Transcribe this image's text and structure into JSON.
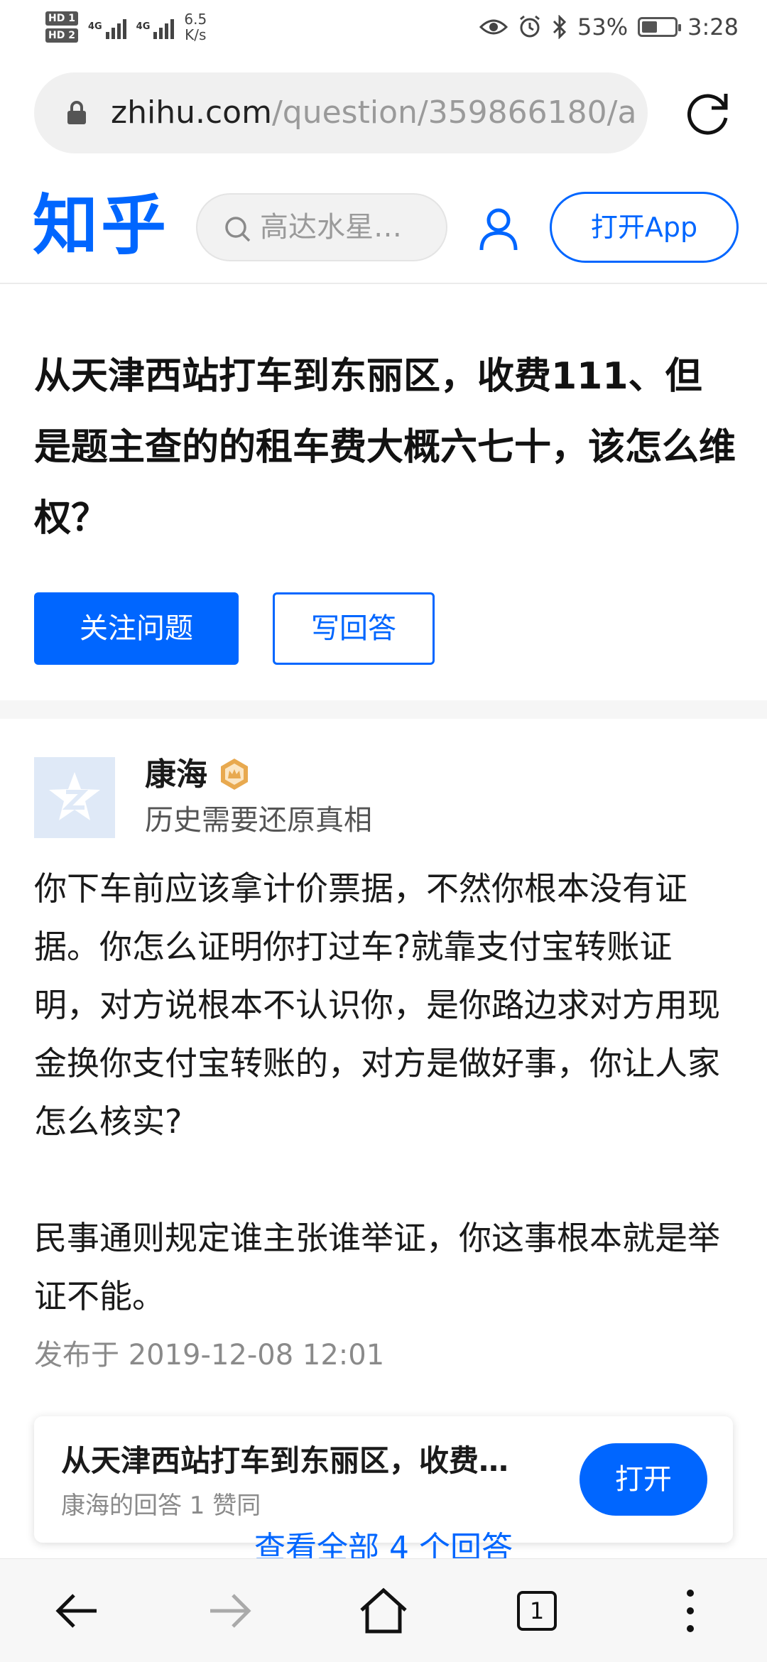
{
  "status_bar": {
    "hd1": "HD 1",
    "hd2": "HD 2",
    "network1": "4G",
    "network2": "4G",
    "speed_value": "6.5",
    "speed_unit": "K/s",
    "battery": "53%",
    "battery_level": 0.53,
    "time": "3:28",
    "icons": [
      "eye-icon",
      "alarm-icon",
      "bluetooth-icon",
      "battery-icon"
    ]
  },
  "url_bar": {
    "host": "zhihu.com",
    "path": "/question/359866180/a"
  },
  "header": {
    "logo": "知乎",
    "search_placeholder": "高达水星…",
    "open_app": "打开App"
  },
  "question": {
    "title": "从天津西站打车到东丽区，收费111、但是题主查的的租车费大概六七十，该怎么维权？",
    "follow_label": "关注问题",
    "answer_label": "写回答"
  },
  "answer": {
    "author": "康海",
    "bio": "历史需要还原真相",
    "paragraphs": [
      "你下车前应该拿计价票据，不然你根本没有证据。你怎么证明你打过车?就靠支付宝转账证明，对方说根本不认识你，是你路边求对方用现金换你支付宝转账的，对方是做好事，你让人家怎么核实?",
      "民事通则规定谁主张谁举证，你这事根本就是举证不能。"
    ],
    "published": "发布于 2019-12-08 12:01"
  },
  "card": {
    "title": "从天津西站打车到东丽区，收费…",
    "meta": "康海的回答 1 赞同",
    "open_label": "打开"
  },
  "view_all": "查看全部 4 个回答",
  "nav": {
    "tab_count": "1"
  },
  "colors": {
    "brand": "#0066ff",
    "badge": "#e8a94f"
  }
}
